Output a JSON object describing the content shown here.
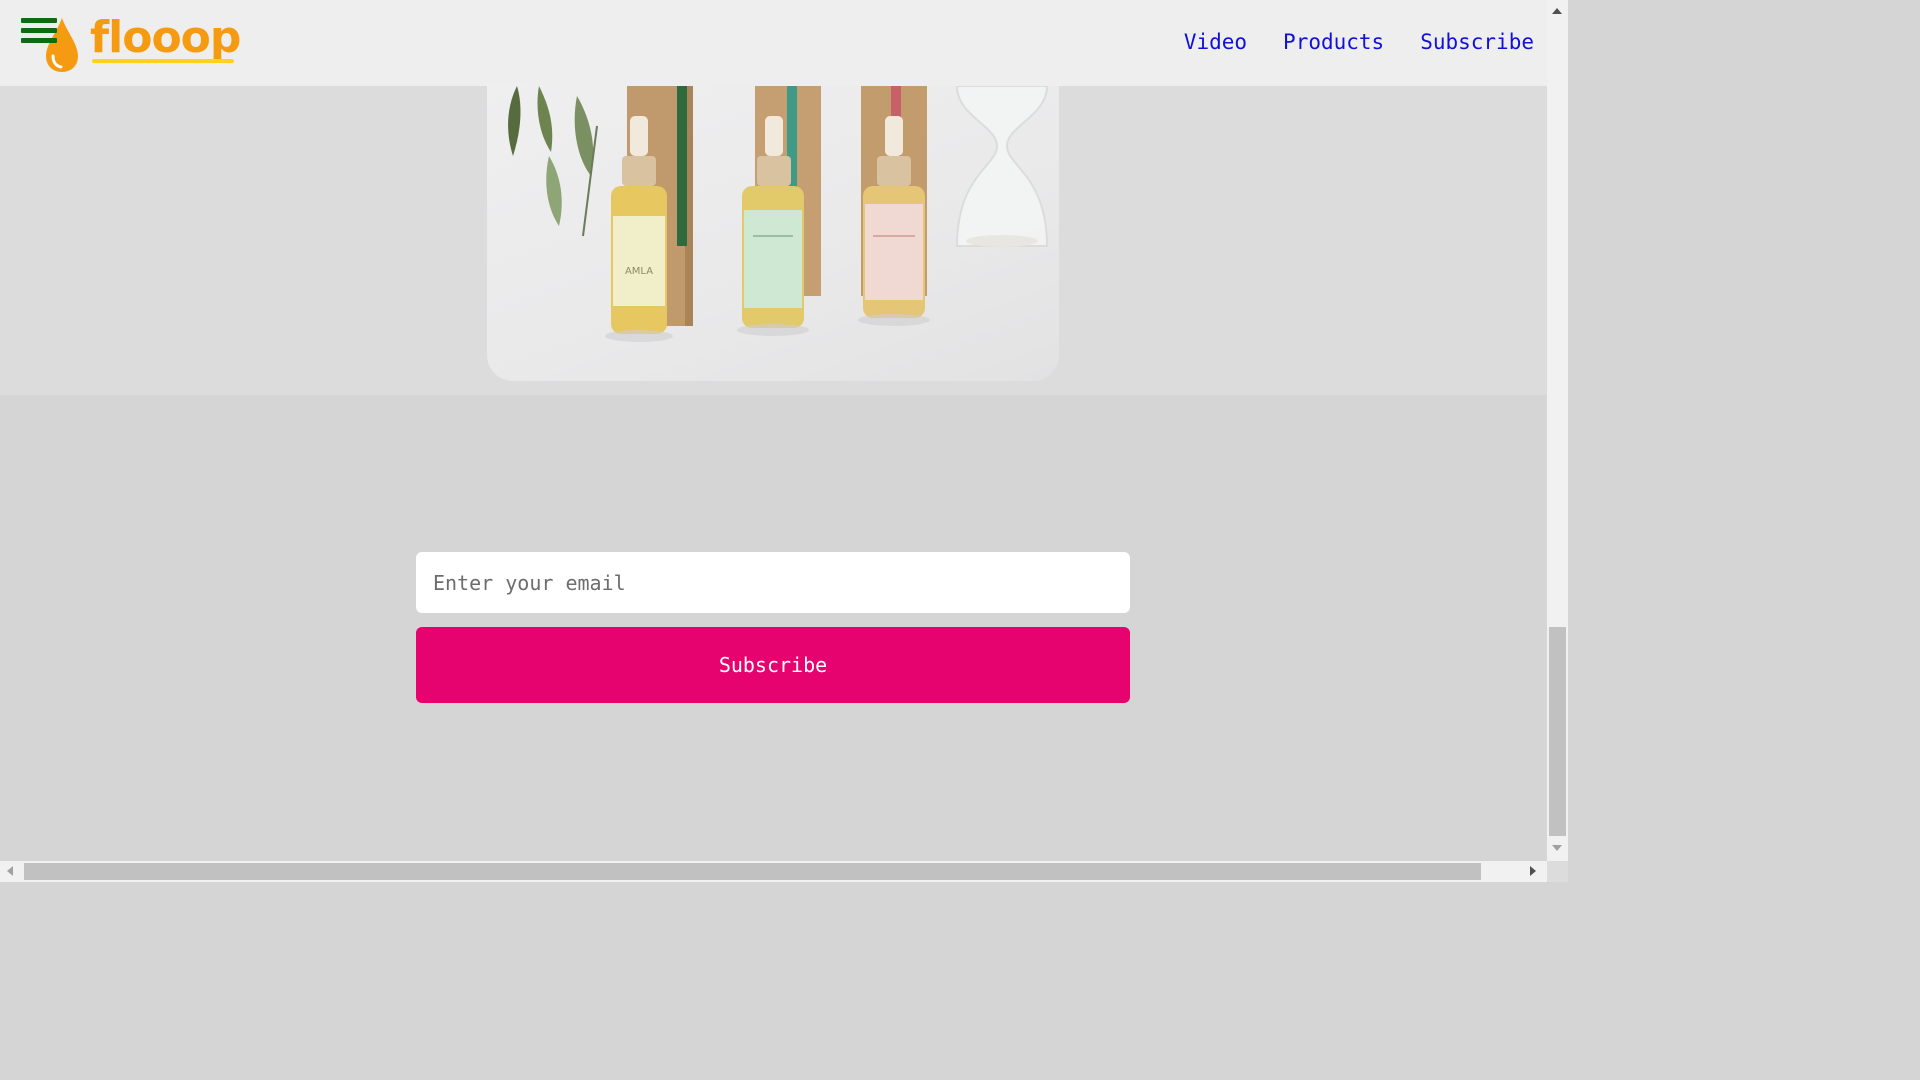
{
  "header": {
    "logo_text": "flooop",
    "nav": [
      {
        "label": "Video"
      },
      {
        "label": "Products"
      },
      {
        "label": "Subscribe"
      }
    ]
  },
  "product_image": {
    "bottles": [
      {
        "label": "AMLA"
      },
      {
        "label": ""
      },
      {
        "label": ""
      }
    ]
  },
  "subscribe": {
    "email_placeholder": "Enter your email",
    "button_label": "Subscribe"
  },
  "colors": {
    "header_bg": "#eeeeee",
    "nav_link": "#1010d8",
    "logo": "#f59b12",
    "hamburger": "#0f6b12",
    "button_bg": "#e6036f",
    "page_bg": "#d5d5d5"
  }
}
